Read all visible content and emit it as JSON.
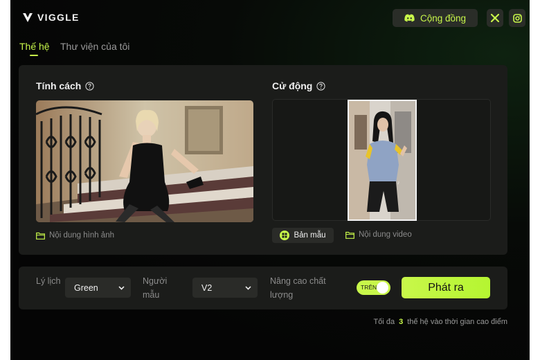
{
  "app": {
    "name": "VIGGLE",
    "accent": "#c8f74a"
  },
  "header": {
    "community_label": "Cộng đồng",
    "icons": [
      "discord-icon",
      "x-icon",
      "instagram-icon"
    ]
  },
  "tabs": [
    {
      "label": "Thế hệ",
      "active": true
    },
    {
      "label": "Thư viện của tôi",
      "active": false
    }
  ],
  "character": {
    "title": "Tính cách",
    "content_label": "Nội dung hình ảnh"
  },
  "motion": {
    "title": "Cử động",
    "template_label": "Bản mẫu",
    "content_label": "Nội dung video"
  },
  "settings": {
    "background_label": "Lý lịch",
    "background_value": "Green",
    "model_label": "Người mẫu",
    "model_value": "V2",
    "quality_label": "Nâng cao chất lượng",
    "quality_toggle_text": "TRÊN",
    "quality_on": true,
    "generate_label": "Phát ra"
  },
  "footnote": {
    "prefix": "Tối đa",
    "count": "3",
    "suffix": "thế hệ vào thời gian cao điểm"
  }
}
